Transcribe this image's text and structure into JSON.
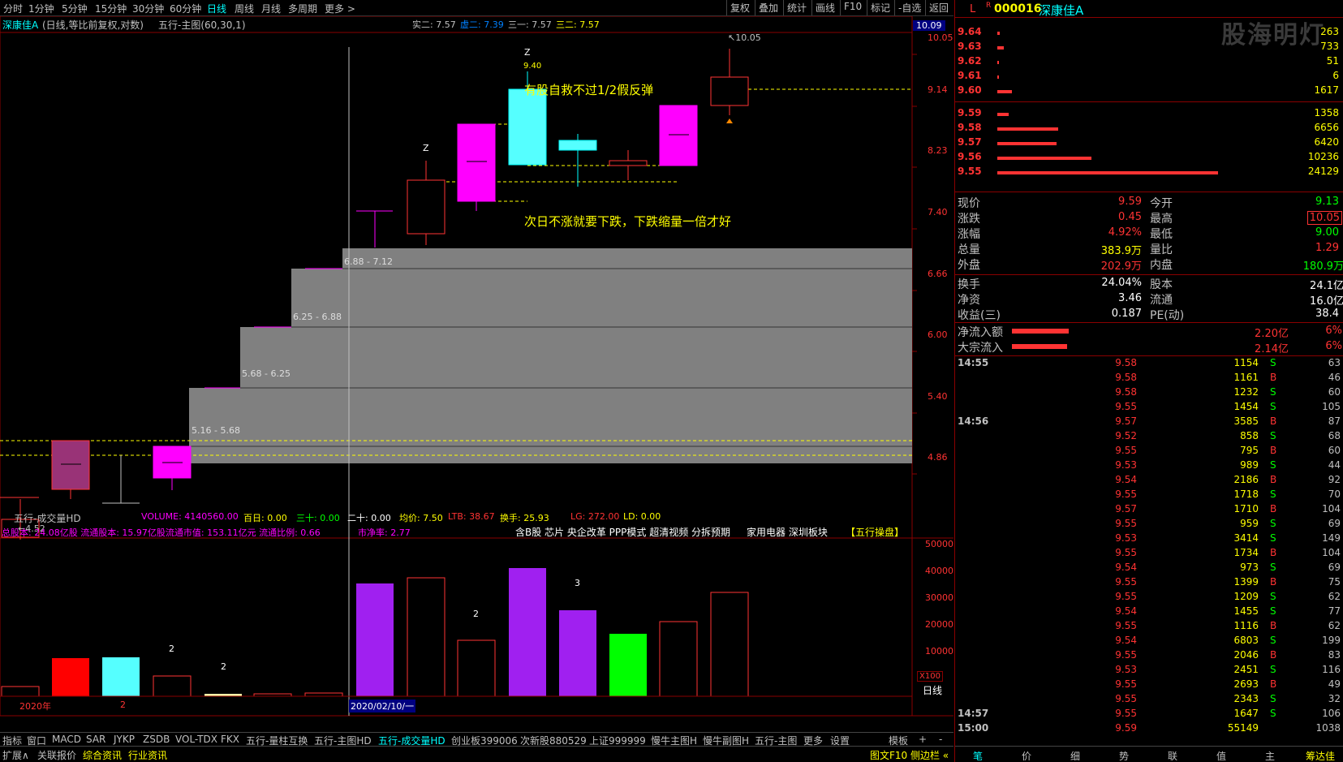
{
  "toolbar": {
    "periods": [
      "分时",
      "1分钟",
      "5分钟",
      "15分钟",
      "30分钟",
      "60分钟",
      "日线",
      "周线",
      "月线",
      "多周期",
      "更多 >"
    ],
    "active_period": "日线",
    "right_buttons": [
      "复权",
      "叠加",
      "统计",
      "画线",
      "F10",
      "标记",
      "-自选",
      "返回"
    ]
  },
  "chart_header": {
    "name": "深康佳A",
    "mode": "(日线,等比前复权,对数)",
    "indicator": "五行-主图(60,30,1)",
    "shi_er": "实二: 7.57",
    "xu_er": "虚二: 7.39",
    "san_yi": "三一: 7.57",
    "san_er": "三二: 7.57",
    "top_price": "10.09"
  },
  "price_axis": [
    "10.05",
    "9.14",
    "8.23",
    "7.40",
    "6.66",
    "6.00",
    "5.40",
    "4.86"
  ],
  "annotations": {
    "high": "10.05",
    "low": "4.52",
    "z1": "Z",
    "z2": "Z",
    "z_price": "9.40",
    "text1": "有股自救不过1/2假反弹",
    "text2": "次日不涨就要下跌，下跌缩量一倍才好",
    "zone1": "6.88 - 7.12",
    "zone2": "6.25 - 6.88",
    "zone3": "5.68 - 6.25",
    "zone4": "5.16 - 5.68"
  },
  "volume_header": {
    "title": "五行-成交量HD",
    "volume": "VOLUME: 4140560.00",
    "bai_ri": "百日: 0.00",
    "san_shi": "三十: 0.00",
    "er_shi": "二十: 0.00",
    "jun_jia": "均价: 7.50",
    "ltb": "LTB: 38.67",
    "huan_shou": "换手: 25.93",
    "lg": "LG: 272.00",
    "ld": "LD: 0.00",
    "info_left": "总股本: 24.08亿股 流通股本: 15.97亿股流通市值: 153.11亿元 流通比例: 0.66",
    "shi_jing": "市净率: 2.77",
    "concepts": "含B股 芯片 央企改革 PPP模式 超清视频 分拆预期",
    "sector": "家用电器  深圳板块",
    "brand": "【五行操盘】",
    "vol_axis": [
      "50000",
      "40000",
      "30000",
      "20000",
      "10000"
    ],
    "unit": "X100",
    "label_2a": "2",
    "label_2b": "2",
    "label_2c": "2",
    "label_3": "3"
  },
  "date_axis": {
    "year": "2020年",
    "month": "2",
    "cursor_date": "2020/02/10/一",
    "period_label": "日线"
  },
  "bottom_tabs": [
    "指标",
    "窗口",
    "MACD",
    "SAR",
    "JYKP",
    "ZSDB",
    "VOL-TDX",
    "FKX",
    "五行-量柱互换",
    "五行-主图HD",
    "五行-成交量HD",
    "创业板399006",
    "次新股880529",
    "上证999999",
    "慢牛主图H",
    "慢牛副图H",
    "五行-主图",
    "更多",
    "设置"
  ],
  "bottom_right": [
    "模板",
    "+",
    "-"
  ],
  "bottom_row2": [
    "扩展∧",
    "关联报价",
    "综合资讯",
    "行业资讯"
  ],
  "bottom_row2_right": "图文F10 侧边栏 «",
  "stock": {
    "prefix_l": "L",
    "prefix_r": "R",
    "code": "000016",
    "name": "深康佳A",
    "watermark": "股海明灯"
  },
  "asks": [
    {
      "price": "9.64",
      "vol": "263",
      "bar": 0.01
    },
    {
      "price": "9.63",
      "vol": "733",
      "bar": 0.03
    },
    {
      "price": "9.62",
      "vol": "51",
      "bar": 0.005
    },
    {
      "price": "9.61",
      "vol": "6",
      "bar": 0.003
    },
    {
      "price": "9.60",
      "vol": "1617",
      "bar": 0.07
    }
  ],
  "bids": [
    {
      "price": "9.59",
      "vol": "1358",
      "bar": 0.06
    },
    {
      "price": "9.58",
      "vol": "6656",
      "bar": 0.28
    },
    {
      "price": "9.57",
      "vol": "6420",
      "bar": 0.27
    },
    {
      "price": "9.56",
      "vol": "10236",
      "bar": 0.43
    },
    {
      "price": "9.55",
      "vol": "24129",
      "bar": 1.0
    }
  ],
  "quote": {
    "xianjia_l": "现价",
    "xianjia": "9.59",
    "jinkai_l": "今开",
    "jinkai": "9.13",
    "zhangdie_l": "涨跌",
    "zhangdie": "0.45",
    "zuigao_l": "最高",
    "zuigao": "10.05",
    "zhangfu_l": "涨幅",
    "zhangfu": "4.92%",
    "zuidi_l": "最低",
    "zuidi": "9.00",
    "zongliang_l": "总量",
    "zongliang": "383.9万",
    "liangbi_l": "量比",
    "liangbi": "1.29",
    "waipan_l": "外盘",
    "waipan": "202.9万",
    "neipan_l": "内盘",
    "neipan": "180.9万",
    "huanshou_l": "换手",
    "huanshou": "24.04%",
    "guben_l": "股本",
    "guben": "24.1亿",
    "jingzi_l": "净资",
    "jingzi": "3.46",
    "liutong_l": "流通",
    "liutong": "16.0亿",
    "shouyi_l": "收益(三)",
    "shouyi": "0.187",
    "pe_l": "PE(动)",
    "pe": "38.4",
    "jingliuru_l": "净流入额",
    "jingliuru": "2.20亿",
    "jingliuru_pct": "6%",
    "dazong_l": "大宗流入",
    "dazong": "2.14亿",
    "dazong_pct": "6%"
  },
  "ticks": [
    {
      "time": "14:55",
      "price": "9.58",
      "vol": "1154",
      "side": "S",
      "n": "63"
    },
    {
      "time": "",
      "price": "9.58",
      "vol": "1161",
      "side": "B",
      "n": "46"
    },
    {
      "time": "",
      "price": "9.58",
      "vol": "1232",
      "side": "S",
      "n": "60"
    },
    {
      "time": "",
      "price": "9.55",
      "vol": "1454",
      "side": "S",
      "n": "105"
    },
    {
      "time": "14:56",
      "price": "9.57",
      "vol": "3585",
      "side": "B",
      "n": "87"
    },
    {
      "time": "",
      "price": "9.52",
      "vol": "858",
      "side": "S",
      "n": "68"
    },
    {
      "time": "",
      "price": "9.55",
      "vol": "795",
      "side": "B",
      "n": "60"
    },
    {
      "time": "",
      "price": "9.53",
      "vol": "989",
      "side": "S",
      "n": "44"
    },
    {
      "time": "",
      "price": "9.54",
      "vol": "2186",
      "side": "B",
      "n": "92"
    },
    {
      "time": "",
      "price": "9.55",
      "vol": "1718",
      "side": "S",
      "n": "70"
    },
    {
      "time": "",
      "price": "9.57",
      "vol": "1710",
      "side": "B",
      "n": "104"
    },
    {
      "time": "",
      "price": "9.55",
      "vol": "959",
      "side": "S",
      "n": "69"
    },
    {
      "time": "",
      "price": "9.53",
      "vol": "3414",
      "side": "S",
      "n": "149"
    },
    {
      "time": "",
      "price": "9.55",
      "vol": "1734",
      "side": "B",
      "n": "104"
    },
    {
      "time": "",
      "price": "9.54",
      "vol": "973",
      "side": "S",
      "n": "69"
    },
    {
      "time": "",
      "price": "9.55",
      "vol": "1399",
      "side": "B",
      "n": "75"
    },
    {
      "time": "",
      "price": "9.55",
      "vol": "1209",
      "side": "S",
      "n": "62"
    },
    {
      "time": "",
      "price": "9.54",
      "vol": "1455",
      "side": "S",
      "n": "77"
    },
    {
      "time": "",
      "price": "9.55",
      "vol": "1116",
      "side": "B",
      "n": "62"
    },
    {
      "time": "",
      "price": "9.54",
      "vol": "6803",
      "side": "S",
      "n": "199"
    },
    {
      "time": "",
      "price": "9.55",
      "vol": "2046",
      "side": "B",
      "n": "83"
    },
    {
      "time": "",
      "price": "9.53",
      "vol": "2451",
      "side": "S",
      "n": "116"
    },
    {
      "time": "",
      "price": "9.55",
      "vol": "2693",
      "side": "B",
      "n": "49"
    },
    {
      "time": "",
      "price": "9.55",
      "vol": "2343",
      "side": "S",
      "n": "32"
    },
    {
      "time": "14:57",
      "price": "9.55",
      "vol": "1647",
      "side": "S",
      "n": "106"
    },
    {
      "time": "15:00",
      "price": "9.59",
      "vol": "55149",
      "side": "",
      "n": "1038"
    }
  ],
  "right_tabs": [
    "笔",
    "价",
    "细",
    "势",
    "联",
    "值",
    "主",
    "筹"
  ],
  "right_tabs_extra": "筹达佳",
  "colors": {
    "up": "#ff3333",
    "down": "#00ffff",
    "magenta": "#ff00ff",
    "yellow": "#ffff00",
    "green": "#00ff00",
    "purple": "#a020f0"
  }
}
